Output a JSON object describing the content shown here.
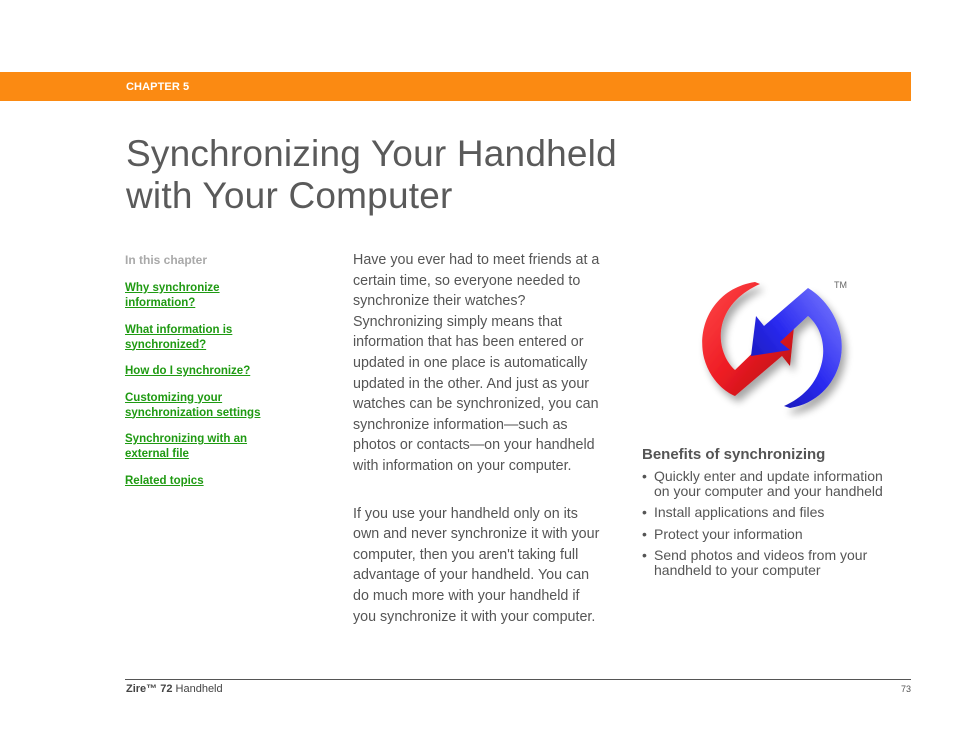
{
  "header": {
    "chapter_label": "CHAPTER 5",
    "accent_color": "#fb8a12"
  },
  "title": {
    "line1": "Synchronizing Your Handheld",
    "line2": "with Your Computer"
  },
  "toc": {
    "heading": "In this chapter",
    "link_color": "#1f9a12",
    "links": [
      {
        "label": "Why synchronize \ninformation?"
      },
      {
        "label": "What information is \nsynchronized?"
      },
      {
        "label": "How do I synchronize?"
      },
      {
        "label": "Customizing your \nsynchronization settings"
      },
      {
        "label": "Synchronizing with an \nexternal file"
      },
      {
        "label": "Related topics"
      }
    ]
  },
  "body": {
    "paragraph1": " Have you ever had to meet friends at a\ncertain time, so everyone needed to\nsynchronize their watches?\nSynchronizing simply means that\ninformation that has been entered or\nupdated in one place is automatically\nupdated in the other. And just as your\nwatches can be synchronized, you can\nsynchronize information—such as\nphotos or contacts—on your handheld\nwith information on your computer.",
    "paragraph2": " If you use your handheld only on its\nown and never synchronize it with your\ncomputer, then you aren't taking full\nadvantage of your handheld. You can\ndo much more with your handheld if\nyou synchronize it with your computer."
  },
  "logo": {
    "icon": "hotsync-icon",
    "trademark": "TM",
    "colors": {
      "red": "#ee1c24",
      "blue": "#2a2af0"
    }
  },
  "benefits": {
    "heading": "Benefits of synchronizing",
    "bullet": "•",
    "items": [
      {
        "line1": "Quickly enter and update information",
        "line2": "on your computer and your handheld"
      },
      {
        "line1": "Install applications and files",
        "line2": ""
      },
      {
        "line1": "Protect your information",
        "line2": ""
      },
      {
        "line1": "Send photos and videos from your",
        "line2": "handheld to your computer"
      }
    ]
  },
  "footer": {
    "brand": "Zire™ 72",
    "product": " Handheld",
    "page_number": "73"
  }
}
